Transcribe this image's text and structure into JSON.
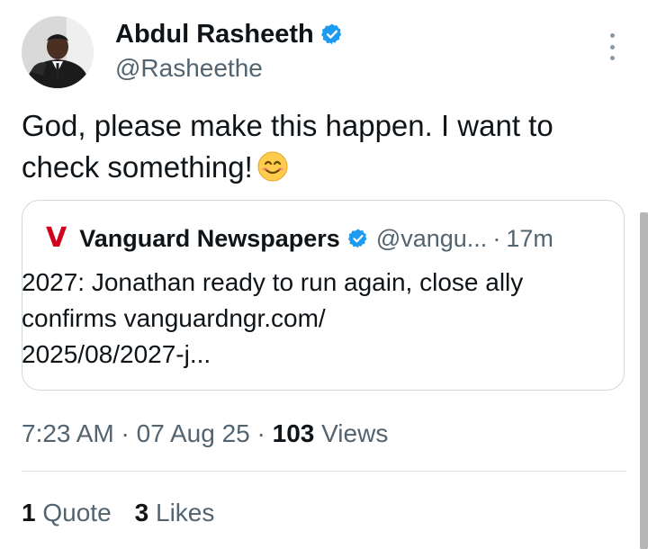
{
  "author": {
    "name": "Abdul Rasheeth",
    "handle": "@Rasheethe",
    "avatar_icon": "profile-photo"
  },
  "tweet": {
    "text": "God, please make this happen. I want to check something!",
    "emoji": "smiling-face-icon"
  },
  "quoted": {
    "logo": "V",
    "name": "Vanguard Newspapers",
    "handle": "@vangu...",
    "separator": "·",
    "time": "17m",
    "text_line1": "2027: Jonathan ready to run again, close ally",
    "text_line2": "confirms vanguardngr.com/",
    "text_line3": "2025/08/2027-j..."
  },
  "meta": {
    "time": "7:23 AM",
    "separator": "·",
    "date": "07 Aug 25",
    "views_count": "103",
    "views_label": "Views"
  },
  "engagement": {
    "quotes_count": "1",
    "quotes_label": "Quote",
    "likes_count": "3",
    "likes_label": "Likes"
  },
  "colors": {
    "text": "#0f1419",
    "secondary": "#536471",
    "verified": "#1d9bf0",
    "brand_red": "#d0021b",
    "border": "#cfd9de"
  }
}
